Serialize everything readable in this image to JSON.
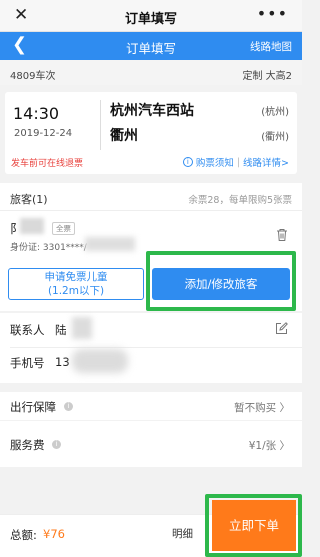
{
  "window": {
    "title": "订单填写",
    "close_icon": "close-icon",
    "more_icon": "more-icon"
  },
  "nav": {
    "back_icon": "chevron-left-icon",
    "title": "订单填写",
    "map_link": "线路地图",
    "color": "#2f8cf0"
  },
  "train": {
    "number": "4809车次",
    "type": "定制  大高2"
  },
  "trip": {
    "depart_time": "14:30",
    "date": "2019-12-24",
    "from": "杭州汽车西站",
    "from_tag": "(杭州)",
    "to": "衢州",
    "to_tag": "(衢州)",
    "refund_note": "发车前可在线退票",
    "notice_link": "购票须知",
    "route_link": "线路详情>"
  },
  "passengers": {
    "heading": "旅客(1)",
    "quota": "余票28，每单限购5张票",
    "name": "阝",
    "ticket_type": "全票",
    "id_line": "身份证: 3301****/",
    "child_button": [
      "申请免票儿童",
      "(1.2m以下)"
    ],
    "add_button": "添加/修改旅客"
  },
  "contact": {
    "name_label": "联系人",
    "name_value": "陆",
    "phone_label": "手机号",
    "phone_value": "13"
  },
  "options": {
    "insurance_label": "出行保障",
    "insurance_value": "暂不购买 〉",
    "fee_label": "服务费",
    "fee_value": "¥1/张 〉"
  },
  "footer": {
    "total_label": "总额:",
    "total_value": "¥76",
    "detail_label": "明细",
    "submit_label": "立即下单",
    "accent_color": "#ff7a1a",
    "highlight_color": "#2db84b"
  }
}
